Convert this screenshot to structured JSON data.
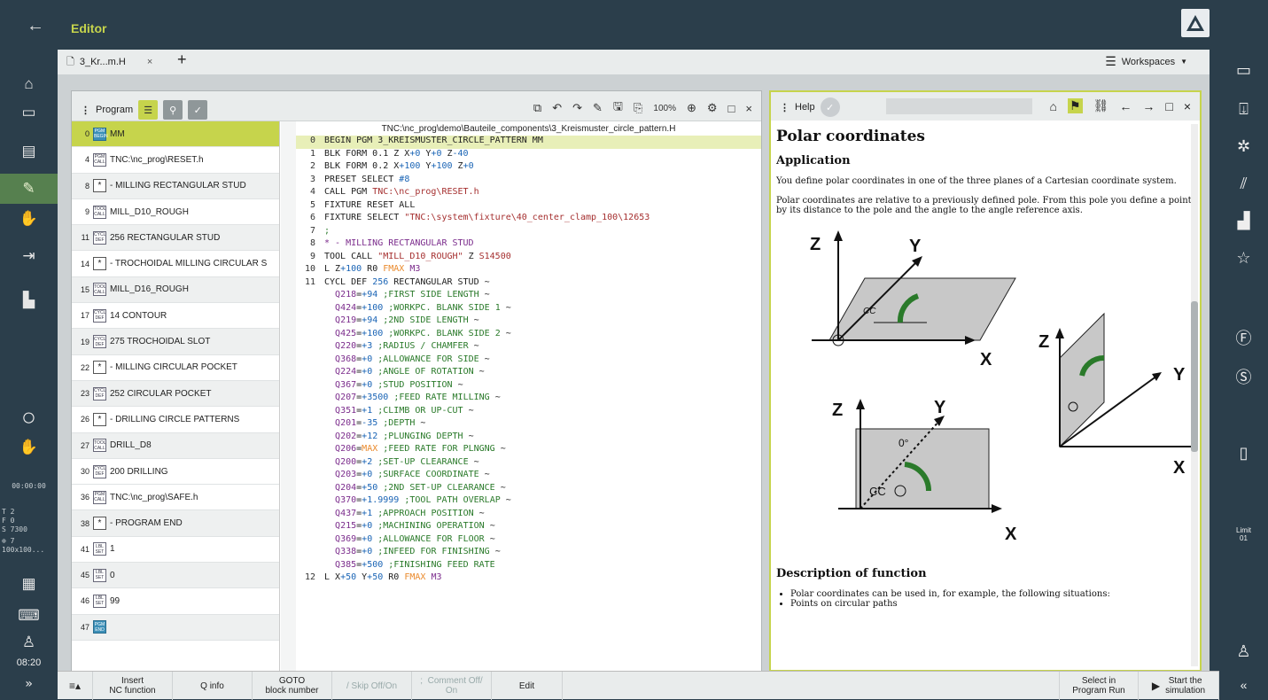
{
  "app": {
    "title": "Editor",
    "back_icon": "back-arrow-icon",
    "logo_icon": "heidenhain-logo-icon"
  },
  "tab": {
    "label": "3_Kr...m.H",
    "close": "×",
    "add": "+"
  },
  "workspaces": {
    "label": "Workspaces"
  },
  "left_sidebar": {
    "items": [
      "home-icon",
      "folder-icon",
      "table-icon",
      "editor-icon",
      "manual-icon",
      "run-icon",
      "machine-icon"
    ],
    "status": {
      "time": "00:00:00",
      "t": "T     2",
      "f": "F     0",
      "s": "S 7300",
      "tool": "⊕    7",
      "dims": "100x100..."
    },
    "clock": "08:20",
    "more": "»"
  },
  "program_panel": {
    "label": "Program",
    "zoom": "100%"
  },
  "outline": [
    {
      "n": "0",
      "badge": "PGM BEGIN",
      "text": "MM",
      "style": "sel"
    },
    {
      "n": "4",
      "badge": "PGM CALL",
      "text": "TNC:\\nc_prog\\RESET.h",
      "style": "w"
    },
    {
      "n": "8",
      "badge": "*",
      "text": "- MILLING RECTANGULAR STUD",
      "style": ""
    },
    {
      "n": "9",
      "badge": "TOOL CALL",
      "text": "MILL_D10_ROUGH",
      "style": "w"
    },
    {
      "n": "11",
      "badge": "CYCL DEF",
      "text": "256 RECTANGULAR STUD",
      "style": ""
    },
    {
      "n": "14",
      "badge": "*",
      "text": "- TROCHOIDAL MILLING CIRCULAR S",
      "style": "w"
    },
    {
      "n": "15",
      "badge": "TOOL CALL",
      "text": "MILL_D16_ROUGH",
      "style": ""
    },
    {
      "n": "17",
      "badge": "CYCL DEF",
      "text": "14 CONTOUR",
      "style": "w"
    },
    {
      "n": "19",
      "badge": "CYCL DEF",
      "text": "275 TROCHOIDAL SLOT",
      "style": ""
    },
    {
      "n": "22",
      "badge": "*",
      "text": "- MILLING CIRCULAR POCKET",
      "style": "w"
    },
    {
      "n": "23",
      "badge": "CYCL DEF",
      "text": "252 CIRCULAR POCKET",
      "style": ""
    },
    {
      "n": "26",
      "badge": "*",
      "text": "- DRILLING CIRCLE PATTERNS",
      "style": "w"
    },
    {
      "n": "27",
      "badge": "TOOL CALL",
      "text": "DRILL_D8",
      "style": ""
    },
    {
      "n": "30",
      "badge": "CYCL DEF",
      "text": "200 DRILLING",
      "style": "w"
    },
    {
      "n": "36",
      "badge": "PGM CALL",
      "text": "TNC:\\nc_prog\\SAFE.h",
      "style": "w"
    },
    {
      "n": "38",
      "badge": "*",
      "text": "- PROGRAM END",
      "style": ""
    },
    {
      "n": "41",
      "badge": "LBL SET",
      "text": "1",
      "style": "w"
    },
    {
      "n": "45",
      "badge": "LBL SET",
      "text": "0",
      "style": ""
    },
    {
      "n": "46",
      "badge": "LBL SET",
      "text": "99",
      "style": "w"
    },
    {
      "n": "47",
      "badge": "PGM END",
      "text": "",
      "style": ""
    }
  ],
  "code": {
    "path": "TNC:\\nc_prog\\demo\\Bauteile_components\\3_Kreismuster_circle_pattern.H",
    "lines": [
      {
        "n": "0",
        "html": "BEGIN PGM 3_KREISMUSTER_CIRCLE_PATTERN MM",
        "hl": true
      },
      {
        "n": "1",
        "html": "BLK FORM 0.1 Z X<span class='num'>+0</span> Y<span class='num'>+0</span> Z<span class='num'>-40</span>"
      },
      {
        "n": "2",
        "html": "BLK FORM 0.2 X<span class='num'>+100</span> Y<span class='num'>+100</span> Z<span class='num'>+0</span>"
      },
      {
        "n": "3",
        "html": "PRESET SELECT <span class='num'>#8</span>"
      },
      {
        "n": "4",
        "html": "CALL PGM <span class='str'>TNC:\\nc_prog\\RESET.h</span>"
      },
      {
        "n": "5",
        "html": "FIXTURE RESET ALL"
      },
      {
        "n": "6",
        "html": "FIXTURE SELECT <span class='str'>\"TNC:\\system\\fixture\\40_center_clamp_100\\12653</span>"
      },
      {
        "n": "7",
        "html": "<span class='cmt'>;</span>"
      },
      {
        "n": "8",
        "html": "<span class='q'>* - MILLING RECTANGULAR STUD</span>"
      },
      {
        "n": "9",
        "html": "TOOL CALL <span class='str'>\"MILL_D10_ROUGH\"</span> Z <span class='str'>S14500</span>"
      },
      {
        "n": "10",
        "html": "L Z<span class='num'>+100</span> R0 <span class='org'>FMAX</span> <span class='q'>M3</span>"
      },
      {
        "n": "11",
        "html": "CYCL DEF <span class='num'>256</span> RECTANGULAR STUD ~"
      },
      {
        "n": "",
        "html": "  <span class='q'>Q218</span>=<span class='num'>+94</span> <span class='cmt'>;FIRST SIDE LENGTH</span> ~"
      },
      {
        "n": "",
        "html": "  <span class='q'>Q424</span>=<span class='num'>+100</span> <span class='cmt'>;WORKPC. BLANK SIDE 1</span> ~"
      },
      {
        "n": "",
        "html": "  <span class='q'>Q219</span>=<span class='num'>+94</span> <span class='cmt'>;2ND SIDE LENGTH</span> ~"
      },
      {
        "n": "",
        "html": "  <span class='q'>Q425</span>=<span class='num'>+100</span> <span class='cmt'>;WORKPC. BLANK SIDE 2</span> ~"
      },
      {
        "n": "",
        "html": "  <span class='q'>Q220</span>=<span class='num'>+3</span> <span class='cmt'>;RADIUS / CHAMFER</span> ~"
      },
      {
        "n": "",
        "html": "  <span class='q'>Q368</span>=<span class='num'>+0</span> <span class='cmt'>;ALLOWANCE FOR SIDE</span> ~"
      },
      {
        "n": "",
        "html": "  <span class='q'>Q224</span>=<span class='num'>+0</span> <span class='cmt'>;ANGLE OF ROTATION</span> ~"
      },
      {
        "n": "",
        "html": "  <span class='q'>Q367</span>=<span class='num'>+0</span> <span class='cmt'>;STUD POSITION</span> ~"
      },
      {
        "n": "",
        "html": "  <span class='q'>Q207</span>=<span class='num'>+3500</span> <span class='cmt'>;FEED RATE MILLING</span> ~"
      },
      {
        "n": "",
        "html": "  <span class='q'>Q351</span>=<span class='num'>+1</span> <span class='cmt'>;CLIMB OR UP-CUT</span> ~"
      },
      {
        "n": "",
        "html": "  <span class='q'>Q201</span>=<span class='num'>-35</span> <span class='cmt'>;DEPTH</span> ~"
      },
      {
        "n": "",
        "html": "  <span class='q'>Q202</span>=<span class='num'>+12</span> <span class='cmt'>;PLUNGING DEPTH</span> ~"
      },
      {
        "n": "",
        "html": "  <span class='q'>Q206</span>=<span class='org'>MAX</span> <span class='cmt'>;FEED RATE FOR PLNGNG</span> ~"
      },
      {
        "n": "",
        "html": "  <span class='q'>Q200</span>=<span class='num'>+2</span> <span class='cmt'>;SET-UP CLEARANCE</span> ~"
      },
      {
        "n": "",
        "html": "  <span class='q'>Q203</span>=<span class='num'>+0</span> <span class='cmt'>;SURFACE COORDINATE</span> ~"
      },
      {
        "n": "",
        "html": "  <span class='q'>Q204</span>=<span class='num'>+50</span> <span class='cmt'>;2ND SET-UP CLEARANCE</span> ~"
      },
      {
        "n": "",
        "html": "  <span class='q'>Q370</span>=<span class='num'>+1.9999</span> <span class='cmt'>;TOOL PATH OVERLAP</span> ~"
      },
      {
        "n": "",
        "html": "  <span class='q'>Q437</span>=<span class='num'>+1</span> <span class='cmt'>;APPROACH POSITION</span> ~"
      },
      {
        "n": "",
        "html": "  <span class='q'>Q215</span>=<span class='num'>+0</span> <span class='cmt'>;MACHINING OPERATION</span> ~"
      },
      {
        "n": "",
        "html": "  <span class='q'>Q369</span>=<span class='num'>+0</span> <span class='cmt'>;ALLOWANCE FOR FLOOR</span> ~"
      },
      {
        "n": "",
        "html": "  <span class='q'>Q338</span>=<span class='num'>+0</span> <span class='cmt'>;INFEED FOR FINISHING</span> ~"
      },
      {
        "n": "",
        "html": "  <span class='q'>Q385</span>=<span class='num'>+500</span> <span class='cmt'>;FINISHING FEED RATE</span>"
      },
      {
        "n": "12",
        "html": "L X<span class='num'>+50</span> Y<span class='num'>+50</span> R0 <span class='org'>FMAX</span> <span class='q'>M3</span>"
      }
    ]
  },
  "help": {
    "label": "Help",
    "title": "Polar coordinates",
    "h_app": "Application",
    "p1": "You define polar coordinates in one of the three planes of a Cartesian coordinate system.",
    "p2": "Polar coordinates are relative to a previously defined pole. From this pole you define a point by its distance to the pole and the angle to the angle reference axis.",
    "h_desc": "Description of function",
    "li1": "Polar coordinates can be used in, for example, the following situations:",
    "li2": "Points on circular paths"
  },
  "bottom": {
    "menu": "≡▴",
    "insert": "Insert\nNC function",
    "qinfo": "Q info",
    "goto": "GOTO\nblock number",
    "skip": "/  Skip Off/On",
    "comment": ";  Comment Off/\nOn",
    "edit": "Edit",
    "select": "Select in\nProgram Run",
    "start": "Start the\nsimulation"
  },
  "right_sidebar": {
    "limit": "Limit\n01",
    "collapse": "«"
  }
}
